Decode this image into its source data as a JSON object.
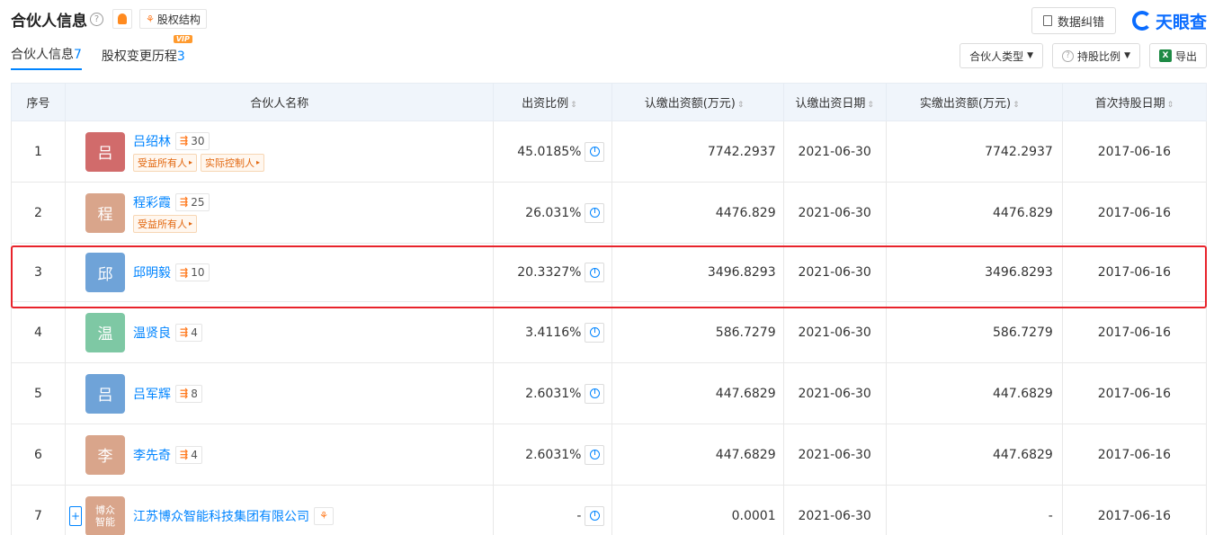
{
  "header": {
    "title": "合伙人信息",
    "help_glyph": "?",
    "structure_label": "股权结构"
  },
  "top_right": {
    "correct_label": "数据纠错",
    "logo_text": "天眼查"
  },
  "tabs": [
    {
      "label": "合伙人信息",
      "count": "7"
    },
    {
      "label": "股权变更历程",
      "count": "3",
      "badge": "VIP"
    }
  ],
  "controls": {
    "type_label": "合伙人类型",
    "ratio_label": "持股比例",
    "export_label": "导出",
    "excel_glyph": "X"
  },
  "columns": {
    "idx": "序号",
    "name": "合伙人名称",
    "ratio": "出资比例",
    "sub": "认缴出资额(万元)",
    "subdate": "认缴出资日期",
    "paid": "实缴出资额(万元)",
    "first": "首次持股日期"
  },
  "rows": [
    {
      "idx": "1",
      "avatar": "吕",
      "avatar_color": "#d16b6b",
      "name": "吕绍林",
      "shares": "30",
      "tags": [
        "受益所有人",
        "实际控制人"
      ],
      "ratio": "45.0185%",
      "sub": "7742.2937",
      "subdate": "2021-06-30",
      "paid": "7742.2937",
      "first": "2017-06-16"
    },
    {
      "idx": "2",
      "avatar": "程",
      "avatar_color": "#d9a58b",
      "name": "程彩霞",
      "shares": "25",
      "tags": [
        "受益所有人"
      ],
      "ratio": "26.031%",
      "sub": "4476.829",
      "subdate": "2021-06-30",
      "paid": "4476.829",
      "first": "2017-06-16"
    },
    {
      "idx": "3",
      "avatar": "邱",
      "avatar_color": "#6fa3d8",
      "name": "邱明毅",
      "shares": "10",
      "tags": [],
      "ratio": "20.3327%",
      "sub": "3496.8293",
      "subdate": "2021-06-30",
      "paid": "3496.8293",
      "first": "2017-06-16"
    },
    {
      "idx": "4",
      "avatar": "温",
      "avatar_color": "#7ec8a4",
      "name": "温贤良",
      "shares": "4",
      "tags": [],
      "ratio": "3.4116%",
      "sub": "586.7279",
      "subdate": "2021-06-30",
      "paid": "586.7279",
      "first": "2017-06-16"
    },
    {
      "idx": "5",
      "avatar": "吕",
      "avatar_color": "#6fa3d8",
      "name": "吕军辉",
      "shares": "8",
      "tags": [],
      "ratio": "2.6031%",
      "sub": "447.6829",
      "subdate": "2021-06-30",
      "paid": "447.6829",
      "first": "2017-06-16"
    },
    {
      "idx": "6",
      "avatar": "李",
      "avatar_color": "#d9a58b",
      "name": "李先奇",
      "shares": "4",
      "tags": [],
      "ratio": "2.6031%",
      "sub": "447.6829",
      "subdate": "2021-06-30",
      "paid": "447.6829",
      "first": "2017-06-16"
    },
    {
      "idx": "7",
      "avatar": "博众智能",
      "avatar_color": "#d9a58b",
      "name": "江苏博众智能科技集团有限公司",
      "shares": "",
      "tags": [],
      "ratio": "-",
      "sub": "0.0001",
      "subdate": "2021-06-30",
      "paid": "-",
      "first": "2017-06-16",
      "is_company": true
    }
  ],
  "highlight_row": "3",
  "colors": {
    "accent": "#0084ff",
    "highlight": "#e8232b",
    "tag_text": "#e2670f"
  }
}
